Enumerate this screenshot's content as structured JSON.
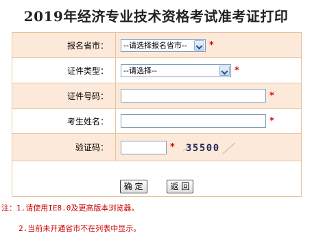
{
  "page": {
    "title": "2019年经济专业技术资格考试准考证打印"
  },
  "form": {
    "province": {
      "label": "报名省市：",
      "selected": "--请选择报名省市--",
      "required_mark": "*"
    },
    "id_type": {
      "label": "证件类型：",
      "selected": "--请选择--",
      "required_mark": "*"
    },
    "id_number": {
      "label": "证件号码：",
      "value": "",
      "required_mark": "*"
    },
    "name": {
      "label": "考生姓名：",
      "value": "",
      "required_mark": "*"
    },
    "captcha": {
      "label": "验证码：",
      "value": "",
      "required_mark": "*",
      "image_text": "35500"
    },
    "buttons": {
      "confirm": "确 定",
      "back": "返 回"
    }
  },
  "notes": {
    "line1": "注：1.请使用IE8.0及更高版本浏览器。",
    "line2": "2.当前未开通省市不在列表中显示。"
  },
  "colors": {
    "odd_row_bg": "#fde9d9",
    "border": "#e6c3a0",
    "required": "#e00000",
    "note_text": "#cc0000"
  }
}
